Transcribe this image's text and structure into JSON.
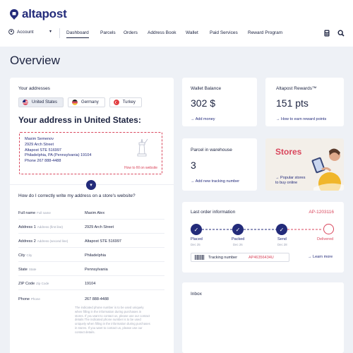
{
  "brand": {
    "name": "altapost",
    "color": "#232b7a",
    "accent": "#d9465c"
  },
  "nav": {
    "account": "Account",
    "links": [
      "Dashboard",
      "Parcels",
      "Orders",
      "Address Book",
      "Wallet",
      "Paid Services",
      "Reward Program"
    ],
    "icons": [
      "calculator-icon",
      "search-icon"
    ]
  },
  "page": {
    "title": "Overview"
  },
  "addresses": {
    "title": "Your addresses",
    "tabs": [
      "United States",
      "Germany",
      "Turkey"
    ],
    "heading": "Your address in United States:",
    "airmail_lines": [
      "Maxim Semenov",
      "2929 Arch Street",
      "Altapost STE 516997",
      "Philadelphia, PA (Pennsylvania) 19104",
      "Phone 267 888-4488"
    ],
    "fill_link": "How to fill on website",
    "question": "How do I correctly write my address on a store's website?",
    "rows": [
      {
        "label": "Full name",
        "hint": "Full name",
        "value": "Maxim Alex"
      },
      {
        "label": "Address 1",
        "hint": "Address (first line)",
        "value": "2929 Arch Street"
      },
      {
        "label": "Address 2",
        "hint": "Address (second line)",
        "value": "Altapost STE 516997"
      },
      {
        "label": "City",
        "hint": "City",
        "value": "Philadelphia"
      },
      {
        "label": "State",
        "hint": "State",
        "value": "Pennsylvania"
      },
      {
        "label": "ZIP Code",
        "hint": "Zip Code",
        "value": "19104"
      },
      {
        "label": "Phone",
        "hint": "Phone",
        "value": "267 888-4488"
      }
    ],
    "phone_note": "The indicated phone number is to be used uniquely when filling in the information during purchases in stores. If you want to contact us, please use our contact details The indicated phone number is to be used uniquely when filling in the information during purchases in stores. If you want to contact us, please use our contact details."
  },
  "wallet": {
    "title": "Wallet Balance",
    "value": "302 $",
    "link": "Add money"
  },
  "rewards": {
    "title": "Altapost Rewards™",
    "value": "151 pts",
    "link": "How to earn reward points"
  },
  "warehouse": {
    "title": "Parcel in warehouse",
    "value": "3",
    "link": "Add new tracking number"
  },
  "stores": {
    "title": "Stores",
    "link": "Popular stores to buy online"
  },
  "order": {
    "title": "Last order information",
    "id": "AP-1203116",
    "steps": [
      {
        "label": "Placed",
        "date": "Dec 25",
        "done": true
      },
      {
        "label": "Packed",
        "date": "Dec 26",
        "done": true
      },
      {
        "label": "Send",
        "date": "Dec 28",
        "done": true
      },
      {
        "label": "Delivered",
        "date": "",
        "done": false
      }
    ],
    "tracking_label": "Tracking number",
    "tracking_number": "AP46356434U",
    "learn_more": "Learn more"
  },
  "inbox": {
    "title": "Inbox"
  }
}
